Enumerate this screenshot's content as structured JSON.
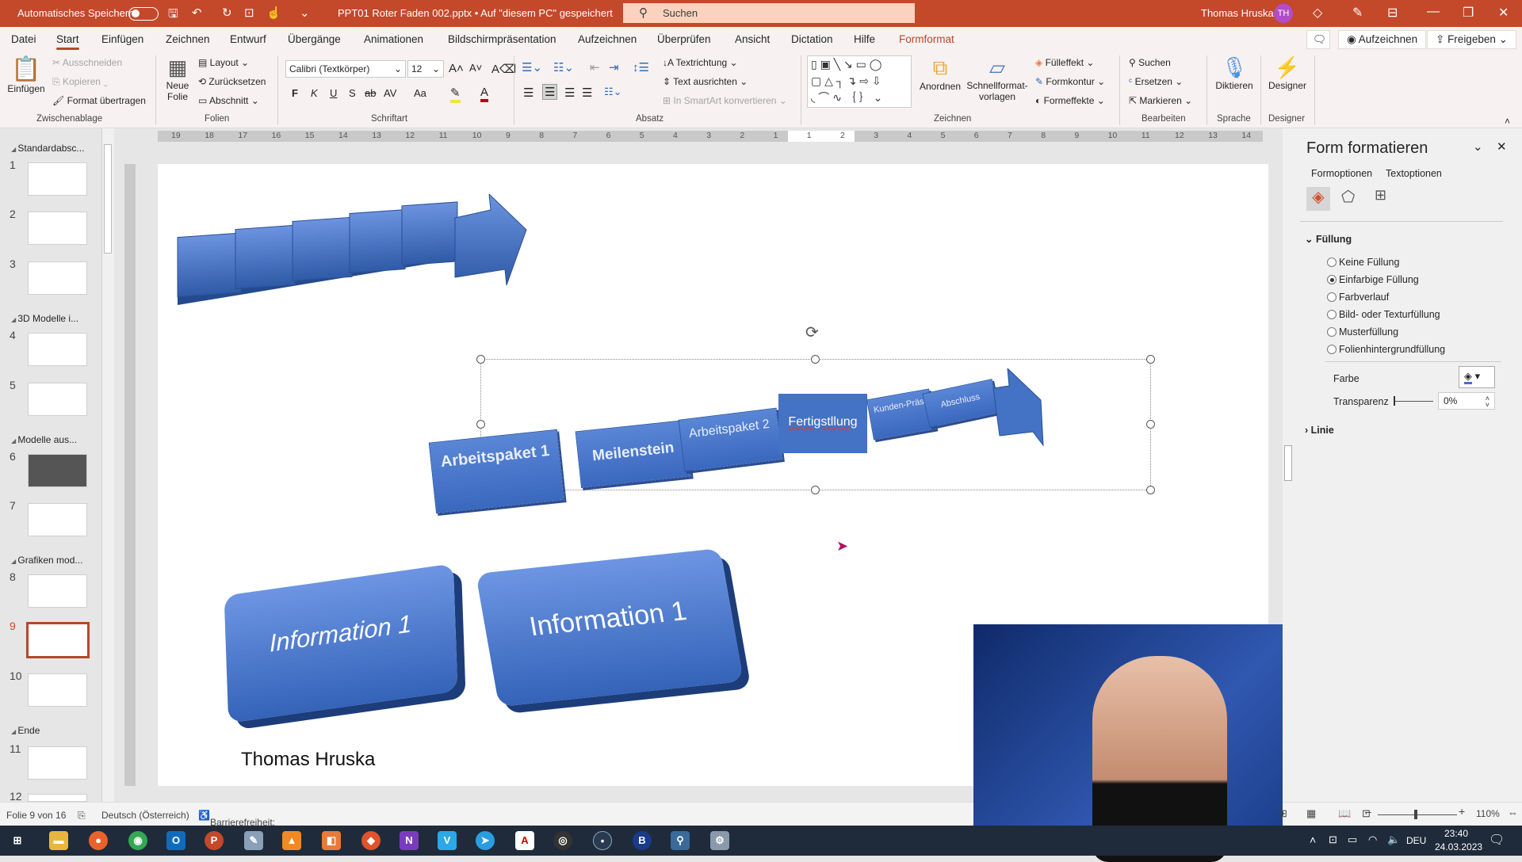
{
  "titlebar": {
    "autosave_label": "Automatisches Speichern",
    "autosave_on": false,
    "doc_title": "PPT01 Roter Faden 002.pptx • Auf \"diesem PC\" gespeichert",
    "search_placeholder": "Suchen",
    "user_name": "Thomas Hruska",
    "user_initials": "TH",
    "icons": [
      "save-icon",
      "undo-icon",
      "redo-icon",
      "present-icon",
      "touch-mode-icon",
      "customize-icon"
    ],
    "window_controls": [
      "diamond-icon",
      "pen-icon",
      "ribbon-display-icon",
      "minimize-icon",
      "restore-icon",
      "close-icon"
    ]
  },
  "menu": {
    "tabs": [
      "Datei",
      "Start",
      "Einfügen",
      "Zeichnen",
      "Entwurf",
      "Übergänge",
      "Animationen",
      "Bildschirmpräsentation",
      "Aufzeichnen",
      "Überprüfen",
      "Ansicht",
      "Dictation",
      "Hilfe",
      "Formformat"
    ],
    "active_tab": "Start",
    "contextual_tab": "Formformat",
    "record_label": "Aufzeichnen",
    "share_label": "Freigeben"
  },
  "ribbon": {
    "clipboard": {
      "paste": "Einfügen",
      "cut": "Ausschneiden",
      "copy": "Kopieren",
      "format_painter": "Format übertragen",
      "group": "Zwischenablage"
    },
    "slides": {
      "new_slide_1": "Neue",
      "new_slide_2": "Folie",
      "layout": "Layout",
      "reset": "Zurücksetzen",
      "section": "Abschnitt",
      "group": "Folien"
    },
    "font": {
      "font_name": "Calibri (Textkörper)",
      "font_size": "12",
      "bold": "F",
      "italic": "K",
      "underline": "U",
      "shadow": "S",
      "strike": "ab",
      "spacing": "AV",
      "case": "Aa",
      "group": "Schriftart"
    },
    "paragraph": {
      "text_direction": "Textrichtung",
      "align_text": "Text ausrichten",
      "smartart": "In SmartArt konvertieren",
      "group": "Absatz"
    },
    "drawing": {
      "arrange": "Anordnen",
      "quick_styles_1": "Schnellformat-",
      "quick_styles_2": "vorlagen",
      "fill": "Fülleffekt",
      "outline": "Formkontur",
      "effects": "Formeffekte",
      "group": "Zeichnen"
    },
    "editing": {
      "find": "Suchen",
      "replace": "Ersetzen",
      "select": "Markieren",
      "group": "Bearbeiten"
    },
    "voice": {
      "dictate": "Diktieren",
      "group": "Sprache"
    },
    "designer": {
      "label": "Designer",
      "group": "Designer"
    }
  },
  "ruler": {
    "ticks": [
      "19",
      "18",
      "17",
      "16",
      "15",
      "14",
      "13",
      "12",
      "11",
      "10",
      "9",
      "8",
      "7",
      "6",
      "5",
      "4",
      "3",
      "2",
      "1",
      "1",
      "2",
      "3",
      "4",
      "5",
      "6",
      "7",
      "8",
      "9",
      "10",
      "11",
      "12",
      "13",
      "14"
    ]
  },
  "thumbnails": {
    "sections": [
      {
        "name": "Standardabsc...",
        "slides": [
          "1",
          "2",
          "3"
        ]
      },
      {
        "name": "3D Modelle i...",
        "slides": [
          "4",
          "5"
        ]
      },
      {
        "name": "Modelle aus...",
        "slides": [
          "6",
          "7"
        ]
      },
      {
        "name": "Grafiken mod...",
        "slides": [
          "8",
          "9",
          "10"
        ]
      },
      {
        "name": "Ende",
        "slides": [
          "11",
          "12"
        ]
      }
    ],
    "selected": "9"
  },
  "slide": {
    "process_boxes": [
      "Arbeitspaket 1",
      "Meilenstein",
      "Arbeitspaket 2",
      "Fertigstllung",
      "Kunden-Präsi",
      "Abschluss"
    ],
    "selected_box": "Fertigstllung",
    "info_left": "Information 1",
    "info_right": "Information 1",
    "author": "Thomas Hruska"
  },
  "format_pane": {
    "title": "Form formatieren",
    "tabs": [
      "Formoptionen",
      "Textoptionen"
    ],
    "fill_section": "Füllung",
    "fill_options": [
      "Keine Füllung",
      "Einfarbige Füllung",
      "Farbverlauf",
      "Bild- oder Texturfüllung",
      "Musterfüllung",
      "Folienhintergrundfüllung"
    ],
    "selected_fill": "Einfarbige Füllung",
    "color_label": "Farbe",
    "transparency_label": "Transparenz",
    "transparency_value": "0%",
    "line_section": "Linie"
  },
  "status": {
    "slide_info": "Folie 9 von 16",
    "language": "Deutsch (Österreich)",
    "accessibility": "Barrierefreiheit: Untersuchen",
    "zoom": "110%"
  },
  "taskbar": {
    "apps": [
      "Start",
      "Explorer",
      "Firefox",
      "Chrome",
      "Outlook",
      "PowerPoint",
      "Paint",
      "VLC",
      "Office",
      "Brave",
      "OneNote",
      "V",
      "Telegram",
      "Acrobat",
      "OBS",
      "Circle",
      "Blue",
      "Search",
      "Tools"
    ],
    "lang": "DEU",
    "time": "23:40",
    "date": "24.03.2023"
  },
  "colors": {
    "accent": "#c4482a",
    "shape_blue": "#4472c4"
  }
}
